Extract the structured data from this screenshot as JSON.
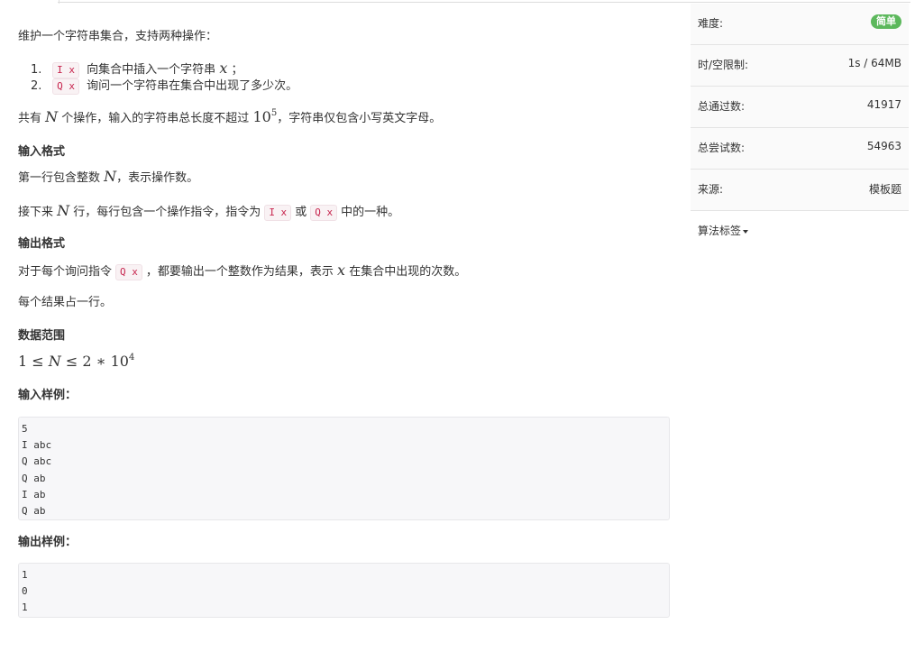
{
  "problem": {
    "intro": "维护一个字符串集合，支持两种操作：",
    "ops": [
      {
        "num": "1.",
        "code": "I x",
        "text_a": "向集合中插入一个字符串",
        "var": "x",
        "text_b": "；"
      },
      {
        "num": "2.",
        "code": "Q x",
        "text_a": "询问一个字符串在集合中出现了多少次。",
        "var": "",
        "text_b": ""
      }
    ],
    "total_a": "共有",
    "total_var": "N",
    "total_b": "个操作，输入的字符串总长度不超过",
    "total_base": "10",
    "total_exp": "5",
    "total_c": "，字符串仅包含小写英文字母。",
    "input_format": {
      "title": "输入格式",
      "line1_a": "第一行包含整数",
      "line1_var": "N",
      "line1_b": "，表示操作数。",
      "line2_a": "接下来",
      "line2_var": "N",
      "line2_b": "行，每行包含一个操作指令，指令为",
      "line2_code1": "I x",
      "line2_c": "或",
      "line2_code2": "Q x",
      "line2_d": "中的一种。"
    },
    "output_format": {
      "title": "输出格式",
      "line1_a": "对于每个询问指令",
      "line1_code": "Q x",
      "line1_b": "，都要输出一个整数作为结果，表示",
      "line1_var": "x",
      "line1_c": "在集合中出现的次数。",
      "line2": "每个结果占一行。"
    },
    "range": {
      "title": "数据范围",
      "expr_a": "1 ≤ ",
      "expr_var": "N",
      "expr_b": " ≤ 2 ∗ 10",
      "expr_exp": "4"
    },
    "sample_input": {
      "title": "输入样例：",
      "lines": [
        "5",
        "I abc",
        "Q abc",
        "Q ab",
        "I ab",
        "Q ab"
      ]
    },
    "sample_output": {
      "title": "输出样例：",
      "lines": [
        "1",
        "0",
        "1"
      ]
    }
  },
  "sidebar": {
    "difficulty_label": "难度:",
    "difficulty_value": "简单",
    "limit_label": "时/空限制:",
    "limit_value": "1s / 64MB",
    "passed_label": "总通过数:",
    "passed_value": "41917",
    "attempts_label": "总尝试数:",
    "attempts_value": "54963",
    "source_label": "来源:",
    "source_value": "模板题",
    "tags_label": "算法标签"
  },
  "colors": {
    "badge": "#5cb85c",
    "code_text": "#c7254e",
    "code_bg": "#f9f2f4"
  }
}
